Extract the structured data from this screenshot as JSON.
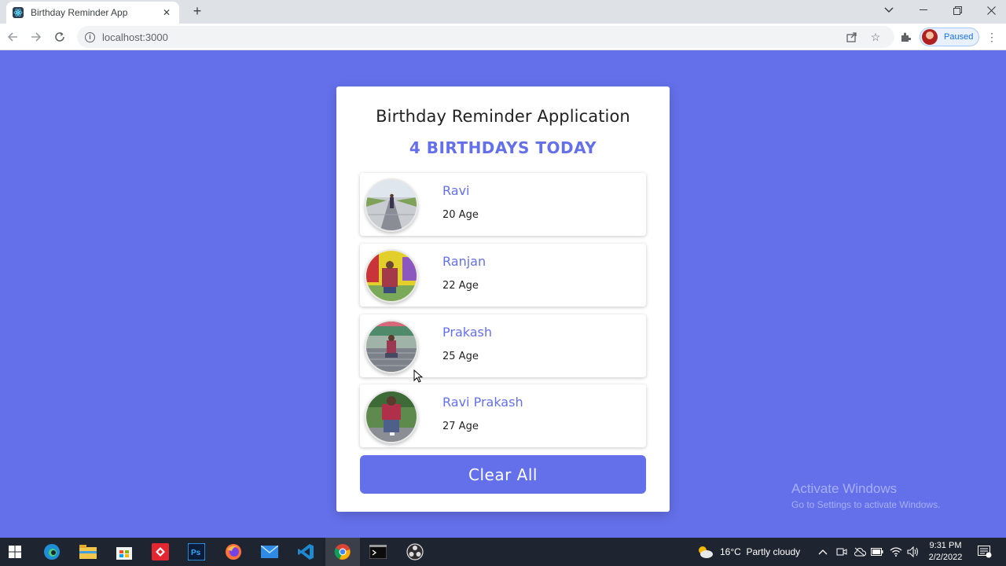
{
  "browser": {
    "tab_title": "Birthday Reminder App",
    "url": "localhost:3000",
    "profile_status": "Paused"
  },
  "app": {
    "title": "Birthday Reminder Application",
    "count_heading": "4 BIRTHDAYS TODAY",
    "people": [
      {
        "name": "Ravi",
        "age": "20 Age"
      },
      {
        "name": "Ranjan",
        "age": "22 Age"
      },
      {
        "name": "Prakash",
        "age": "25 Age"
      },
      {
        "name": "Ravi Prakash",
        "age": "27 Age"
      }
    ],
    "clear_label": "Clear All"
  },
  "watermark": {
    "title": "Activate Windows",
    "subtitle": "Go to Settings to activate Windows."
  },
  "taskbar": {
    "weather": "16°C  Partly cloudy",
    "time": "9:31 PM",
    "date": "2/2/2022"
  },
  "colors": {
    "background": "#6470ea",
    "accent": "#6470ea"
  }
}
